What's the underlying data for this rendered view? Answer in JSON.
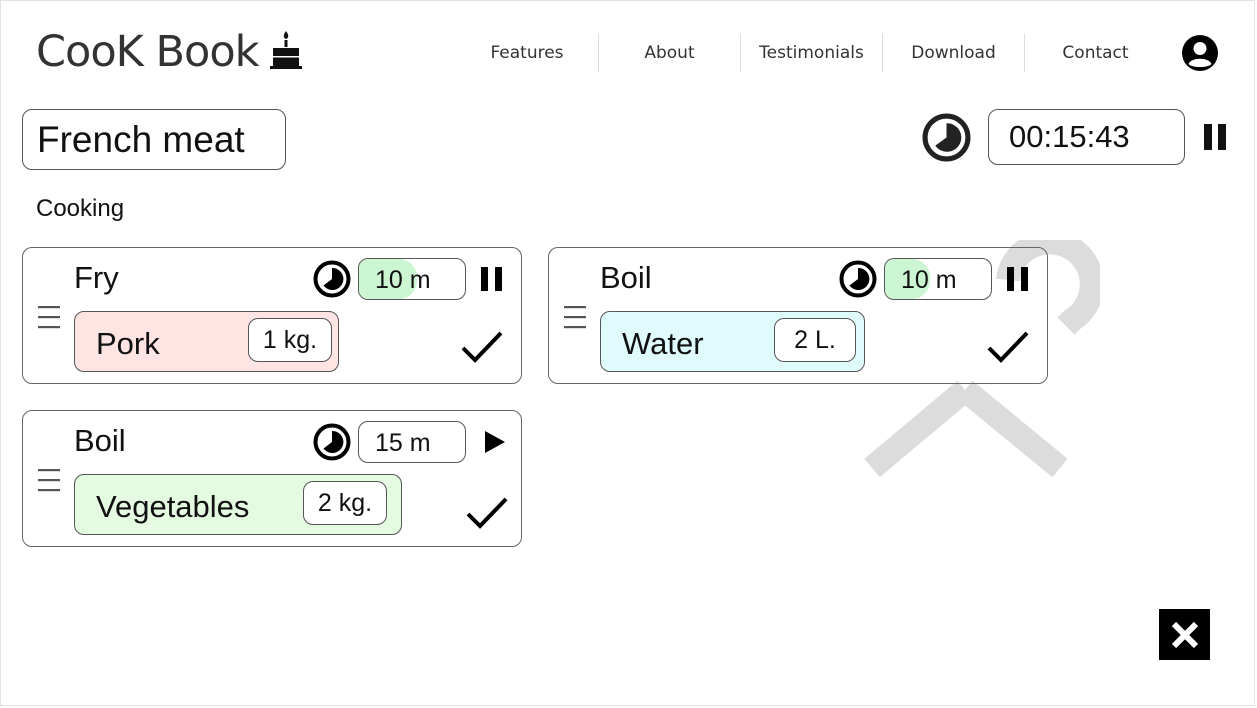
{
  "header": {
    "brand": "CooK Book",
    "brand_icon": "cake-icon",
    "nav": [
      {
        "label": "Features"
      },
      {
        "label": "About"
      },
      {
        "label": "Testimonials"
      },
      {
        "label": "Download"
      },
      {
        "label": "Contact"
      }
    ],
    "user_icon": "user-account-icon"
  },
  "recipe": {
    "title": "French meat",
    "timer": "00:15:43",
    "timer_state": "running"
  },
  "section_label": "Cooking",
  "steps": [
    {
      "name": "Fry",
      "duration": "10 m",
      "progress": 0.55,
      "control": "pause",
      "ingredient": {
        "name": "Pork",
        "quantity": "1 kg.",
        "color": "#ffe4e4"
      }
    },
    {
      "name": "Boil",
      "duration": "10 m",
      "progress": 0.42,
      "control": "pause",
      "ingredient": {
        "name": "Water",
        "quantity": "2 L.",
        "color": "#e0fbfb"
      }
    },
    {
      "name": "Boil",
      "duration": "15 m",
      "progress": 0,
      "control": "play",
      "ingredient": {
        "name": "Vegetables",
        "quantity": "2 kg.",
        "color": "#e4fbe2"
      }
    }
  ],
  "colors": {
    "progress_fill": "#ccf5d2",
    "watermark": "#dcdcdc"
  }
}
